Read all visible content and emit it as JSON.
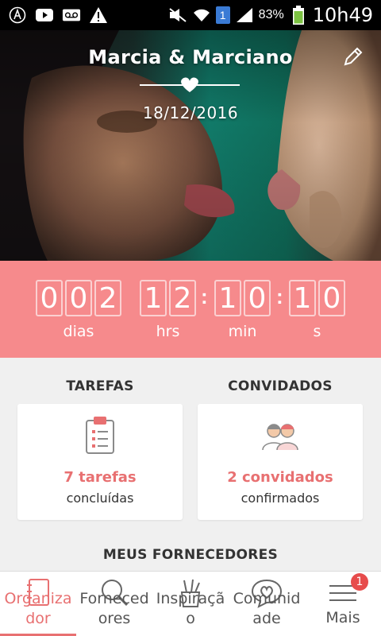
{
  "status_bar": {
    "battery_percent": "83%",
    "time": "10h49",
    "sim_slot": "1"
  },
  "hero": {
    "title": "Marcia & Marciano",
    "date": "18/12/2016"
  },
  "countdown": {
    "days": [
      "0",
      "0",
      "2"
    ],
    "hours": [
      "1",
      "2"
    ],
    "minutes": [
      "1",
      "0"
    ],
    "seconds": [
      "1",
      "0"
    ],
    "labels": {
      "days": "dias",
      "hours": "hrs",
      "minutes": "min",
      "seconds": "s"
    }
  },
  "tasks": {
    "heading": "TAREFAS",
    "value": "7 tarefas",
    "sub": "concluídas"
  },
  "guests": {
    "heading": "CONVIDADOS",
    "value": "2 convidados",
    "sub": "confirmados"
  },
  "providers_heading": "MEUS FORNECEDORES",
  "nav": {
    "items": [
      {
        "label": "Organizador",
        "icon": "notebook-icon"
      },
      {
        "label": "Fornecedores",
        "icon": "search-icon"
      },
      {
        "label": "Inspiração",
        "icon": "pencil-cup-icon"
      },
      {
        "label": "Comunidade",
        "icon": "chat-heart-icon"
      },
      {
        "label": "Mais",
        "icon": "menu-icon"
      }
    ],
    "badge": "1"
  },
  "colors": {
    "accent": "#f68a8c",
    "accent_text": "#e87071",
    "badge": "#e74c4c"
  }
}
